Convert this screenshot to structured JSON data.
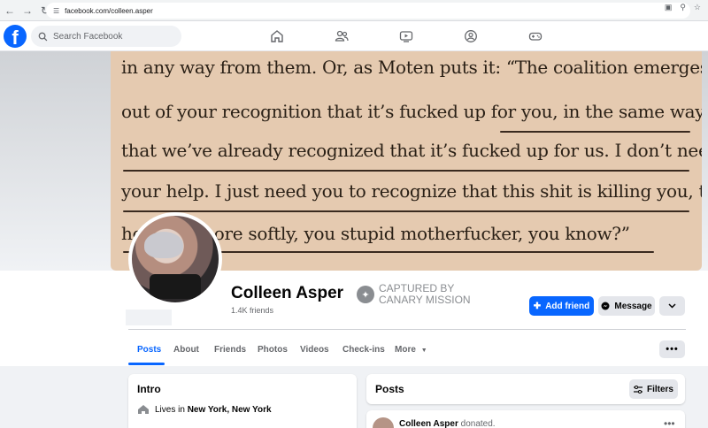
{
  "browser": {
    "url": "facebook.com/colleen.asper"
  },
  "topbar": {
    "search_placeholder": "Search Facebook",
    "nav_icons": [
      "home-icon",
      "friends-icon",
      "video-icon",
      "groups-icon",
      "gaming-icon"
    ]
  },
  "cover": {
    "lines": [
      "in any way from them. Or, as Moten puts it: “The coalition emerges",
      "out of your recognition that it’s fucked up for you, in the same way",
      "that we’ve already recognized that it’s fucked up for us. I don’t need",
      "your help. I just need you to recognize that this shit is killing you, too,",
      "ho…uch more softly, you stupid motherfucker, you know?”"
    ]
  },
  "profile": {
    "name": "Colleen Asper",
    "friends": "1.4K friends",
    "badge_line1": "CAPTURED BY",
    "badge_line2": "CANARY MISSION"
  },
  "actions": {
    "add_friend": "Add friend",
    "message": "Message"
  },
  "tabs": [
    {
      "label": "Posts",
      "active": true
    },
    {
      "label": "About"
    },
    {
      "label": "Friends"
    },
    {
      "label": "Photos"
    },
    {
      "label": "Videos"
    },
    {
      "label": "Check-ins"
    },
    {
      "label": "More"
    }
  ],
  "intro": {
    "title": "Intro",
    "lives_prefix": "Lives in ",
    "lives_place": "New York, New York"
  },
  "posts": {
    "title": "Posts",
    "filters": "Filters",
    "first_post_author": "Colleen Asper",
    "first_post_action": " donated."
  },
  "colors": {
    "brand": "#0866ff",
    "muted": "#65676b",
    "button_bg": "#e4e6eb"
  }
}
